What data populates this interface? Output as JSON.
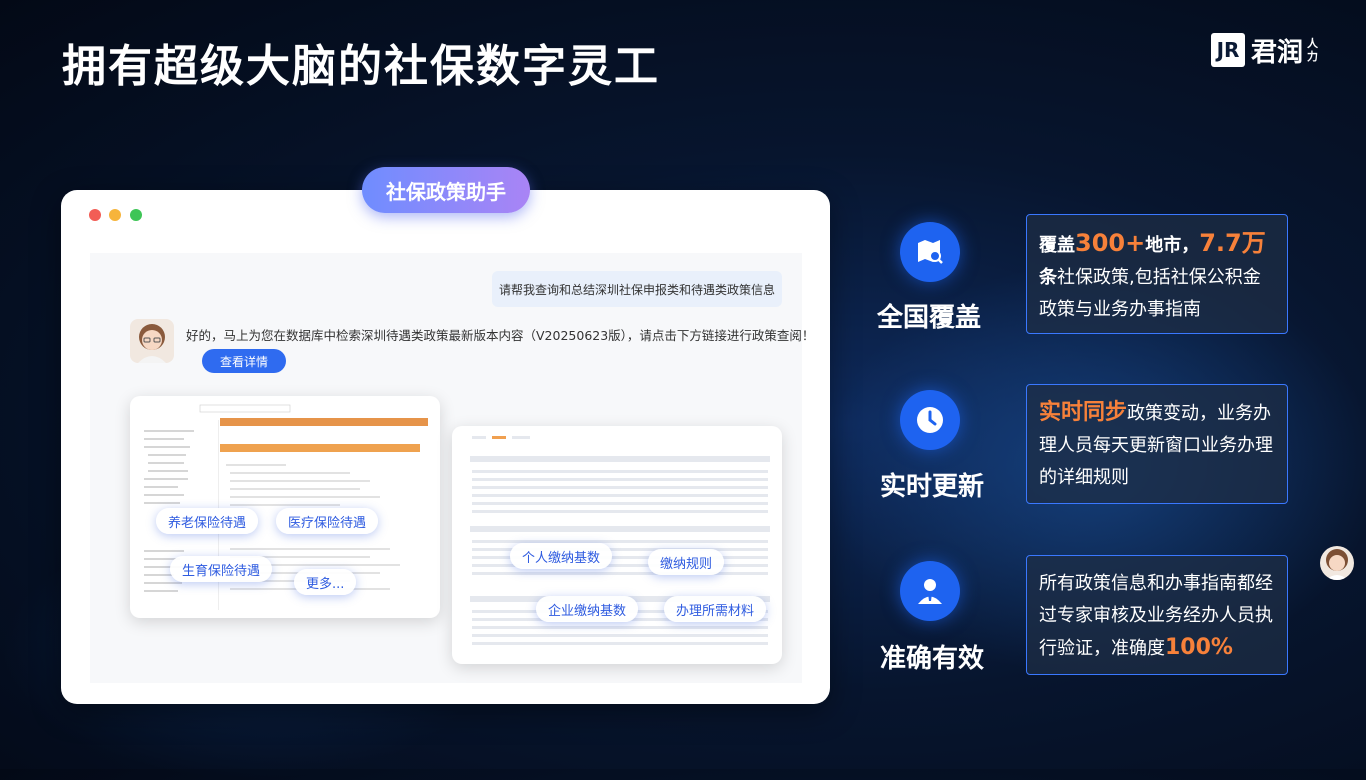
{
  "title": "拥有超级大脑的社保数字灵工",
  "logo": {
    "mark": "JR",
    "name": "君润",
    "sub": "人力"
  },
  "window": {
    "tag": "社保政策助手",
    "user_message": "请帮我查询和总结深圳社保申报类和待遇类政策信息",
    "assistant_message": "好的，马上为您在数据库中检索深圳待遇类政策最新版本内容（V20250623版），请点击下方链接进行政策查阅！",
    "detail_button": "查看详情",
    "chips_left": [
      "养老保险待遇",
      "医疗保险待遇",
      "生育保险待遇",
      "更多..."
    ],
    "chips_right": [
      "个人缴纳基数",
      "缴纳规则",
      "企业缴纳基数",
      "办理所需材料"
    ]
  },
  "features": [
    {
      "label": "全国覆盖",
      "icon": "map-search-icon",
      "parts": [
        {
          "text": "覆盖",
          "style": "bold"
        },
        {
          "text": "300+",
          "style": "hl"
        },
        {
          "text": "地市，",
          "style": "bold"
        },
        {
          "text": "7.7万",
          "style": "hl"
        },
        {
          "text": "条",
          "style": "bold"
        },
        {
          "text": "社保政策,包括社保公积金政策与业务办事指南",
          "style": ""
        }
      ]
    },
    {
      "label": "实时更新",
      "icon": "clock-icon",
      "parts": [
        {
          "text": "实时同步",
          "style": "hl2"
        },
        {
          "text": "政策变动，业务办理人员每天更新窗口业务办理的详细规则",
          "style": ""
        }
      ]
    },
    {
      "label": "准确有效",
      "icon": "user-badge-icon",
      "parts": [
        {
          "text": "所有政策信息和办事指南都经过专家审核及业务经办人员执行验证，准确度",
          "style": ""
        },
        {
          "text": "100%",
          "style": "hl2"
        }
      ]
    }
  ],
  "colors": {
    "accent": "#1e63f0",
    "highlight": "#f7813a",
    "card_border": "#3a78ff"
  }
}
